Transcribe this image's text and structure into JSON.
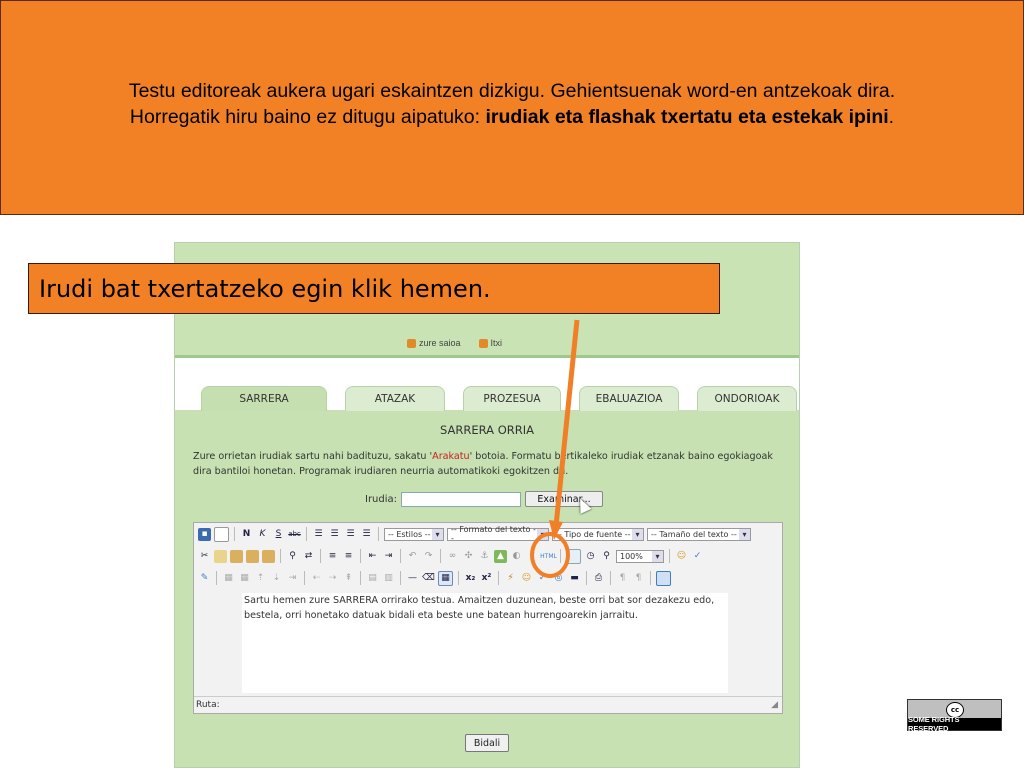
{
  "banner": {
    "line1": "Testu editoreak aukera ugari eskaintzen dizkigu. Gehientsuenak word-en antzekoak dira.",
    "line2_prefix": "Horregatik hiru baino ez ditugu aipatuko: ",
    "line2_bold": "irudiak eta flashak txertatu eta estekak ipini",
    "line2_suffix": "."
  },
  "callout": {
    "text": "Irudi bat txertatzeko egin klik hemen."
  },
  "app": {
    "top_links": [
      "zure saioa",
      "Itxi"
    ],
    "tabs": [
      "SARRERA",
      "ATAZAK",
      "PROZESUA",
      "EBALUAZIOA",
      "ONDORIOAK"
    ],
    "panel_title": "SARRERA ORRIA",
    "desc_part1": "Zure orrietan irudiak sartu nahi badituzu, sakatu '",
    "desc_red": "Arakatu",
    "desc_part2": "' botoia. Formatu bertikaleko irudiak etzanak baino egokiagoak dira bantiloi honetan. Programak irudiaren neurria automatikoki egokitzen du.",
    "irudia_label": "Irudia:",
    "irudia_value": "",
    "browse_label": "Examinar...",
    "editor": {
      "style_select": "-- Estilos --",
      "format_select": "-- Formato del texto --",
      "font_select": "-- Tipo de fuente --",
      "size_select": "-- Tamaño del texto --",
      "zoom_select": "100%",
      "content": "Sartu hemen zure SARRERA orrirako testua. Amaitzen duzunean, beste orri bat sor dezakezu edo, bestela, orri honetako datuak bidali eta beste une batean hurrengoarekin jarraitu.",
      "path_label": "Ruta:"
    },
    "send_label": "Bidali"
  },
  "license": {
    "text": "SOME RIGHTS RESERVED",
    "logo": "cc"
  },
  "colors": {
    "accent": "#f28126",
    "panel": "#c7e1b3",
    "arrow": "#f07f28"
  }
}
